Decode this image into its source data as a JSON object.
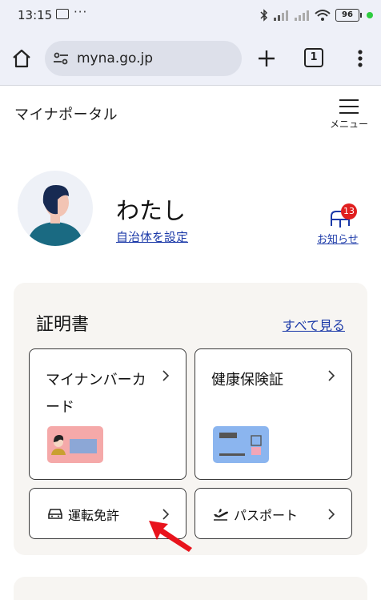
{
  "status_bar": {
    "time": "13:15",
    "more": "···",
    "battery": "96"
  },
  "browser": {
    "url": "myna.go.jp",
    "tab_count": "1"
  },
  "site": {
    "logo": "マイナポータル",
    "menu_label": "メニュー"
  },
  "user": {
    "name": "わたし",
    "set_municipality": "自治体を設定",
    "notice_label": "お知らせ",
    "notice_count": "13"
  },
  "certificates": {
    "title": "証明書",
    "see_all": "すべて見る",
    "mynumber_card": "マイナンバーカード",
    "health_insurance": "健康保険証",
    "drivers_license": "運転免許",
    "passport": "パスポート"
  },
  "colors": {
    "link": "#1b39a8",
    "badge": "#e01f1f",
    "panel_bg": "#f7f5f2",
    "arrow": "#e8131c"
  }
}
